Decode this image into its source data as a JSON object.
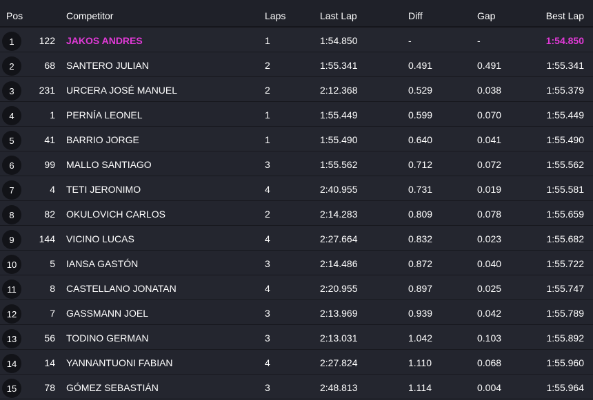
{
  "headers": {
    "pos": "Pos",
    "competitor": "Competitor",
    "laps": "Laps",
    "last_lap": "Last Lap",
    "diff": "Diff",
    "gap": "Gap",
    "best_lap": "Best Lap"
  },
  "colors": {
    "highlight": "#e23ad8",
    "background": "#23252e"
  },
  "rows": [
    {
      "pos": "1",
      "number": "122",
      "competitor": "JAKOS ANDRES",
      "laps": "1",
      "last_lap": "1:54.850",
      "diff": "-",
      "gap": "-",
      "best_lap": "1:54.850"
    },
    {
      "pos": "2",
      "number": "68",
      "competitor": "SANTERO JULIAN",
      "laps": "2",
      "last_lap": "1:55.341",
      "diff": "0.491",
      "gap": "0.491",
      "best_lap": "1:55.341"
    },
    {
      "pos": "3",
      "number": "231",
      "competitor": "URCERA JOSÉ MANUEL",
      "laps": "2",
      "last_lap": "2:12.368",
      "diff": "0.529",
      "gap": "0.038",
      "best_lap": "1:55.379"
    },
    {
      "pos": "4",
      "number": "1",
      "competitor": "PERNÍA LEONEL",
      "laps": "1",
      "last_lap": "1:55.449",
      "diff": "0.599",
      "gap": "0.070",
      "best_lap": "1:55.449"
    },
    {
      "pos": "5",
      "number": "41",
      "competitor": "BARRIO JORGE",
      "laps": "1",
      "last_lap": "1:55.490",
      "diff": "0.640",
      "gap": "0.041",
      "best_lap": "1:55.490"
    },
    {
      "pos": "6",
      "number": "99",
      "competitor": "MALLO SANTIAGO",
      "laps": "3",
      "last_lap": "1:55.562",
      "diff": "0.712",
      "gap": "0.072",
      "best_lap": "1:55.562"
    },
    {
      "pos": "7",
      "number": "4",
      "competitor": "TETI JERONIMO",
      "laps": "4",
      "last_lap": "2:40.955",
      "diff": "0.731",
      "gap": "0.019",
      "best_lap": "1:55.581"
    },
    {
      "pos": "8",
      "number": "82",
      "competitor": "OKULOVICH CARLOS",
      "laps": "2",
      "last_lap": "2:14.283",
      "diff": "0.809",
      "gap": "0.078",
      "best_lap": "1:55.659"
    },
    {
      "pos": "9",
      "number": "144",
      "competitor": "VICINO LUCAS",
      "laps": "4",
      "last_lap": "2:27.664",
      "diff": "0.832",
      "gap": "0.023",
      "best_lap": "1:55.682"
    },
    {
      "pos": "10",
      "number": "5",
      "competitor": "IANSA GASTÓN",
      "laps": "3",
      "last_lap": "2:14.486",
      "diff": "0.872",
      "gap": "0.040",
      "best_lap": "1:55.722"
    },
    {
      "pos": "11",
      "number": "8",
      "competitor": "CASTELLANO JONATAN",
      "laps": "4",
      "last_lap": "2:20.955",
      "diff": "0.897",
      "gap": "0.025",
      "best_lap": "1:55.747"
    },
    {
      "pos": "12",
      "number": "7",
      "competitor": "GASSMANN JOEL",
      "laps": "3",
      "last_lap": "2:13.969",
      "diff": "0.939",
      "gap": "0.042",
      "best_lap": "1:55.789"
    },
    {
      "pos": "13",
      "number": "56",
      "competitor": "TODINO GERMAN",
      "laps": "3",
      "last_lap": "2:13.031",
      "diff": "1.042",
      "gap": "0.103",
      "best_lap": "1:55.892"
    },
    {
      "pos": "14",
      "number": "14",
      "competitor": "YANNANTUONI FABIAN",
      "laps": "4",
      "last_lap": "2:27.824",
      "diff": "1.110",
      "gap": "0.068",
      "best_lap": "1:55.960"
    },
    {
      "pos": "15",
      "number": "78",
      "competitor": "GÓMEZ SEBASTIÁN",
      "laps": "3",
      "last_lap": "2:48.813",
      "diff": "1.114",
      "gap": "0.004",
      "best_lap": "1:55.964"
    }
  ]
}
